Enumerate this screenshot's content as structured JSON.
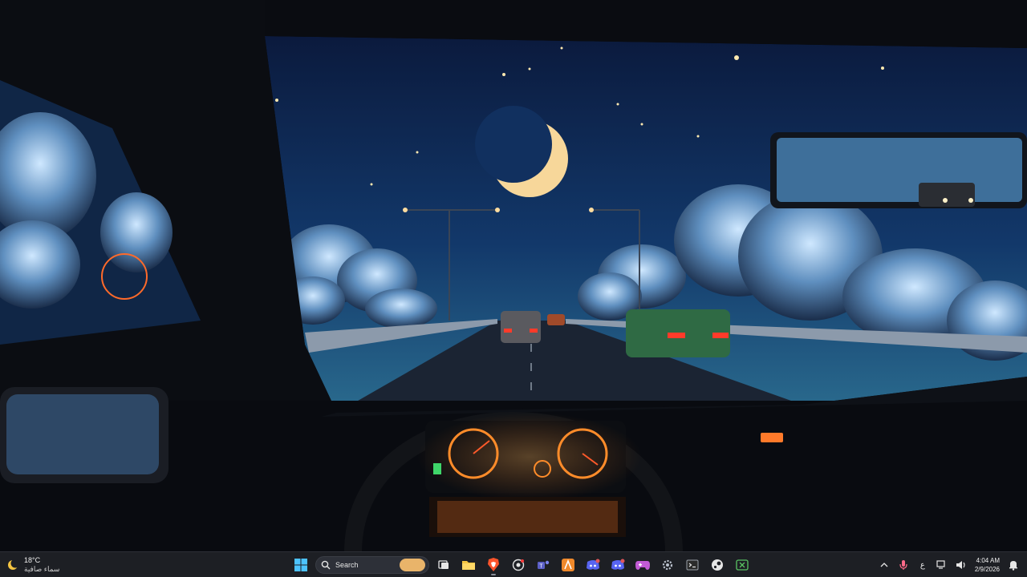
{
  "weather": {
    "temperature": "18°C",
    "description": "سماء صافية",
    "icon": "moon-icon"
  },
  "taskbar": {
    "search_label": "Search",
    "apps": [
      {
        "name": "start-menu",
        "icon": "windows-logo-icon"
      },
      {
        "name": "task-view",
        "icon": "task-view-icon"
      },
      {
        "name": "file-explorer",
        "icon": "folder-icon"
      },
      {
        "name": "brave-browser",
        "icon": "brave-lion-icon"
      },
      {
        "name": "browser-2",
        "icon": "browser-icon"
      },
      {
        "name": "teams",
        "icon": "teams-icon"
      },
      {
        "name": "affinity",
        "icon": "affinity-icon"
      },
      {
        "name": "discord",
        "icon": "discord-icon"
      },
      {
        "name": "discord-2",
        "icon": "discord-icon"
      },
      {
        "name": "game-controller",
        "icon": "game-controller-icon"
      },
      {
        "name": "settings",
        "icon": "gear-icon"
      },
      {
        "name": "terminal",
        "icon": "terminal-icon"
      },
      {
        "name": "steam",
        "icon": "steam-icon"
      },
      {
        "name": "xbox",
        "icon": "xbox-icon"
      }
    ]
  },
  "tray": {
    "language": "ع",
    "time": "4:04 AM",
    "date": "2/9/2026"
  },
  "colors": {
    "taskbar_bg": "#1d1f24",
    "accent_blue": "#4cc2ff",
    "brave_orange": "#fb542b"
  }
}
